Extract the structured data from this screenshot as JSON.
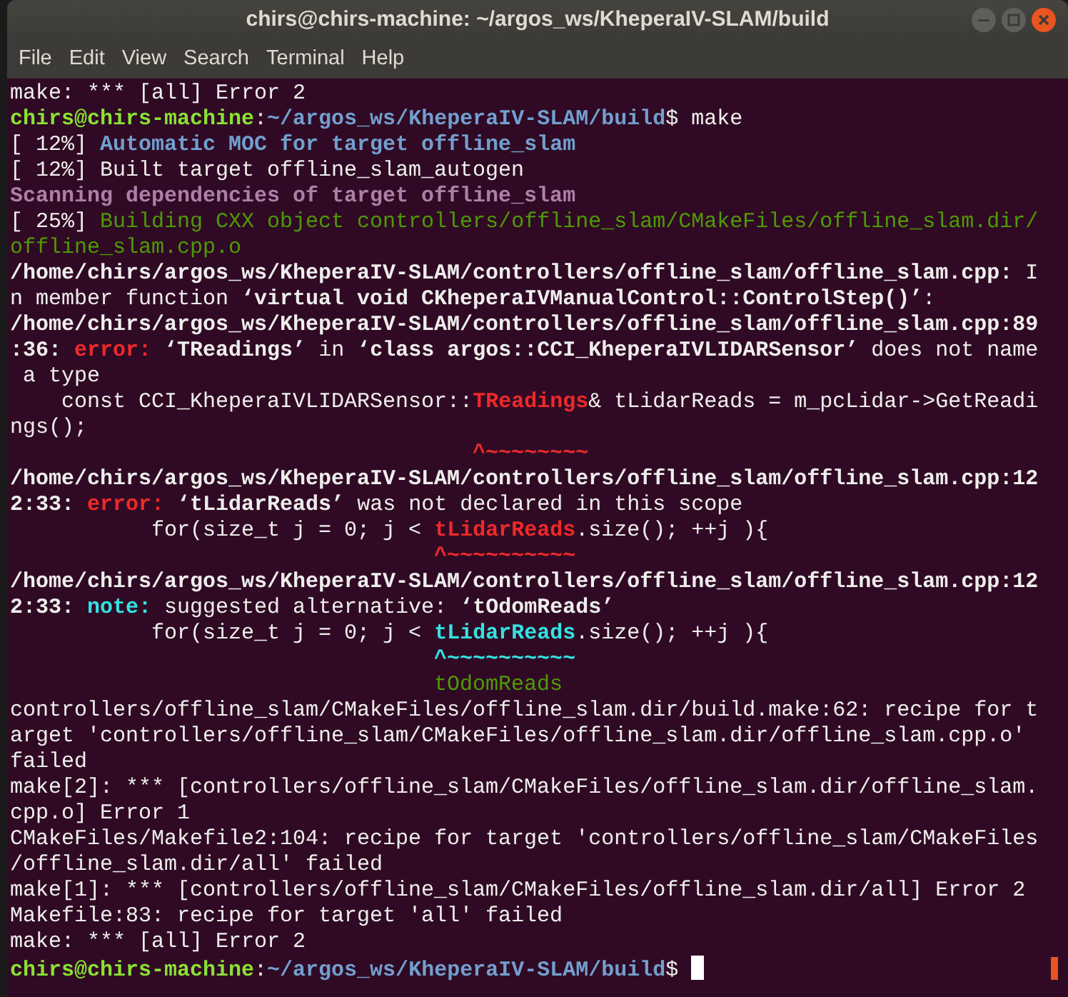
{
  "window": {
    "title": "chirs@chirs-machine: ~/argos_ws/KheperaIV-SLAM/build"
  },
  "menu": [
    "File",
    "Edit",
    "View",
    "Search",
    "Terminal",
    "Help"
  ],
  "terminal": {
    "lines": [
      [
        {
          "kind": "plain",
          "text": "make: *** [all] Error 2"
        }
      ],
      [
        {
          "kind": "user",
          "text": "chirs@chirs-machine"
        },
        {
          "kind": "plain",
          "text": ":"
        },
        {
          "kind": "path",
          "text": "~/argos_ws/KheperaIV-SLAM/build"
        },
        {
          "kind": "plain",
          "text": "$ make"
        }
      ],
      [
        {
          "kind": "plain",
          "text": "[ 12%] "
        },
        {
          "kind": "blue",
          "text": "Automatic MOC for target offline_slam"
        }
      ],
      [
        {
          "kind": "plain",
          "text": "[ 12%] Built target offline_slam_autogen"
        }
      ],
      [
        {
          "kind": "purple",
          "text": "Scanning dependencies of target offline_slam"
        }
      ],
      [
        {
          "kind": "plain",
          "text": "[ 25%] "
        },
        {
          "kind": "green",
          "text": "Building CXX object controllers/offline_slam/CMakeFiles/offline_slam.dir/"
        }
      ],
      [
        {
          "kind": "green",
          "text": "offline_slam.cpp.o"
        }
      ],
      [
        {
          "kind": "bold",
          "text": "/home/chirs/argos_ws/KheperaIV-SLAM/controllers/offline_slam/offline_slam.cpp:"
        },
        {
          "kind": "plain",
          "text": " I"
        }
      ],
      [
        {
          "kind": "plain",
          "text": "n member function "
        },
        {
          "kind": "bold",
          "text": "‘virtual void CKheperaIVManualControl::ControlStep()’"
        },
        {
          "kind": "plain",
          "text": ":"
        }
      ],
      [
        {
          "kind": "bold",
          "text": "/home/chirs/argos_ws/KheperaIV-SLAM/controllers/offline_slam/offline_slam.cpp:89"
        }
      ],
      [
        {
          "kind": "bold",
          "text": ":36: "
        },
        {
          "kind": "red",
          "text": "error: "
        },
        {
          "kind": "bold",
          "text": "‘TReadings’"
        },
        {
          "kind": "plain",
          "text": " in "
        },
        {
          "kind": "bold",
          "text": "‘class argos::CCI_KheperaIVLIDARSensor’"
        },
        {
          "kind": "plain",
          "text": " does not name"
        }
      ],
      [
        {
          "kind": "plain",
          "text": " a type"
        }
      ],
      [
        {
          "kind": "plain",
          "text": "    const CCI_KheperaIVLIDARSensor::"
        },
        {
          "kind": "red",
          "text": "TReadings"
        },
        {
          "kind": "plain",
          "text": "& tLidarReads = m_pcLidar->GetReadi"
        }
      ],
      [
        {
          "kind": "plain",
          "text": "ngs();"
        }
      ],
      [
        {
          "kind": "red",
          "text": "                                    ^~~~~~~~~"
        }
      ],
      [
        {
          "kind": "bold",
          "text": "/home/chirs/argos_ws/KheperaIV-SLAM/controllers/offline_slam/offline_slam.cpp:12"
        }
      ],
      [
        {
          "kind": "bold",
          "text": "2:33: "
        },
        {
          "kind": "red",
          "text": "error: "
        },
        {
          "kind": "bold",
          "text": "‘tLidarReads’"
        },
        {
          "kind": "plain",
          "text": " was not declared in this scope"
        }
      ],
      [
        {
          "kind": "plain",
          "text": "           for(size_t j = 0; j < "
        },
        {
          "kind": "red",
          "text": "tLidarReads"
        },
        {
          "kind": "plain",
          "text": ".size(); ++j ){"
        }
      ],
      [
        {
          "kind": "red",
          "text": "                                 ^~~~~~~~~~~"
        }
      ],
      [
        {
          "kind": "bold",
          "text": "/home/chirs/argos_ws/KheperaIV-SLAM/controllers/offline_slam/offline_slam.cpp:12"
        }
      ],
      [
        {
          "kind": "bold",
          "text": "2:33: "
        },
        {
          "kind": "cyan",
          "text": "note: "
        },
        {
          "kind": "plain",
          "text": "suggested alternative: "
        },
        {
          "kind": "bold",
          "text": "‘tOdomReads’"
        }
      ],
      [
        {
          "kind": "plain",
          "text": "           for(size_t j = 0; j < "
        },
        {
          "kind": "cyan",
          "text": "tLidarReads"
        },
        {
          "kind": "plain",
          "text": ".size(); ++j ){"
        }
      ],
      [
        {
          "kind": "cyan",
          "text": "                                 ^~~~~~~~~~~"
        }
      ],
      [
        {
          "kind": "green",
          "text": "                                 tOdomReads"
        }
      ],
      [
        {
          "kind": "plain",
          "text": "controllers/offline_slam/CMakeFiles/offline_slam.dir/build.make:62: recipe for t"
        }
      ],
      [
        {
          "kind": "plain",
          "text": "arget 'controllers/offline_slam/CMakeFiles/offline_slam.dir/offline_slam.cpp.o'"
        }
      ],
      [
        {
          "kind": "plain",
          "text": "failed"
        }
      ],
      [
        {
          "kind": "plain",
          "text": "make[2]: *** [controllers/offline_slam/CMakeFiles/offline_slam.dir/offline_slam."
        }
      ],
      [
        {
          "kind": "plain",
          "text": "cpp.o] Error 1"
        }
      ],
      [
        {
          "kind": "plain",
          "text": "CMakeFiles/Makefile2:104: recipe for target 'controllers/offline_slam/CMakeFiles"
        }
      ],
      [
        {
          "kind": "plain",
          "text": "/offline_slam.dir/all' failed"
        }
      ],
      [
        {
          "kind": "plain",
          "text": "make[1]: *** [controllers/offline_slam/CMakeFiles/offline_slam.dir/all] Error 2"
        }
      ],
      [
        {
          "kind": "plain",
          "text": "Makefile:83: recipe for target 'all' failed"
        }
      ],
      [
        {
          "kind": "plain",
          "text": "make: *** [all] Error 2"
        }
      ],
      [
        {
          "kind": "user",
          "text": "chirs@chirs-machine"
        },
        {
          "kind": "plain",
          "text": ":"
        },
        {
          "kind": "path",
          "text": "~/argos_ws/KheperaIV-SLAM/build"
        },
        {
          "kind": "plain",
          "text": "$ "
        }
      ]
    ]
  }
}
